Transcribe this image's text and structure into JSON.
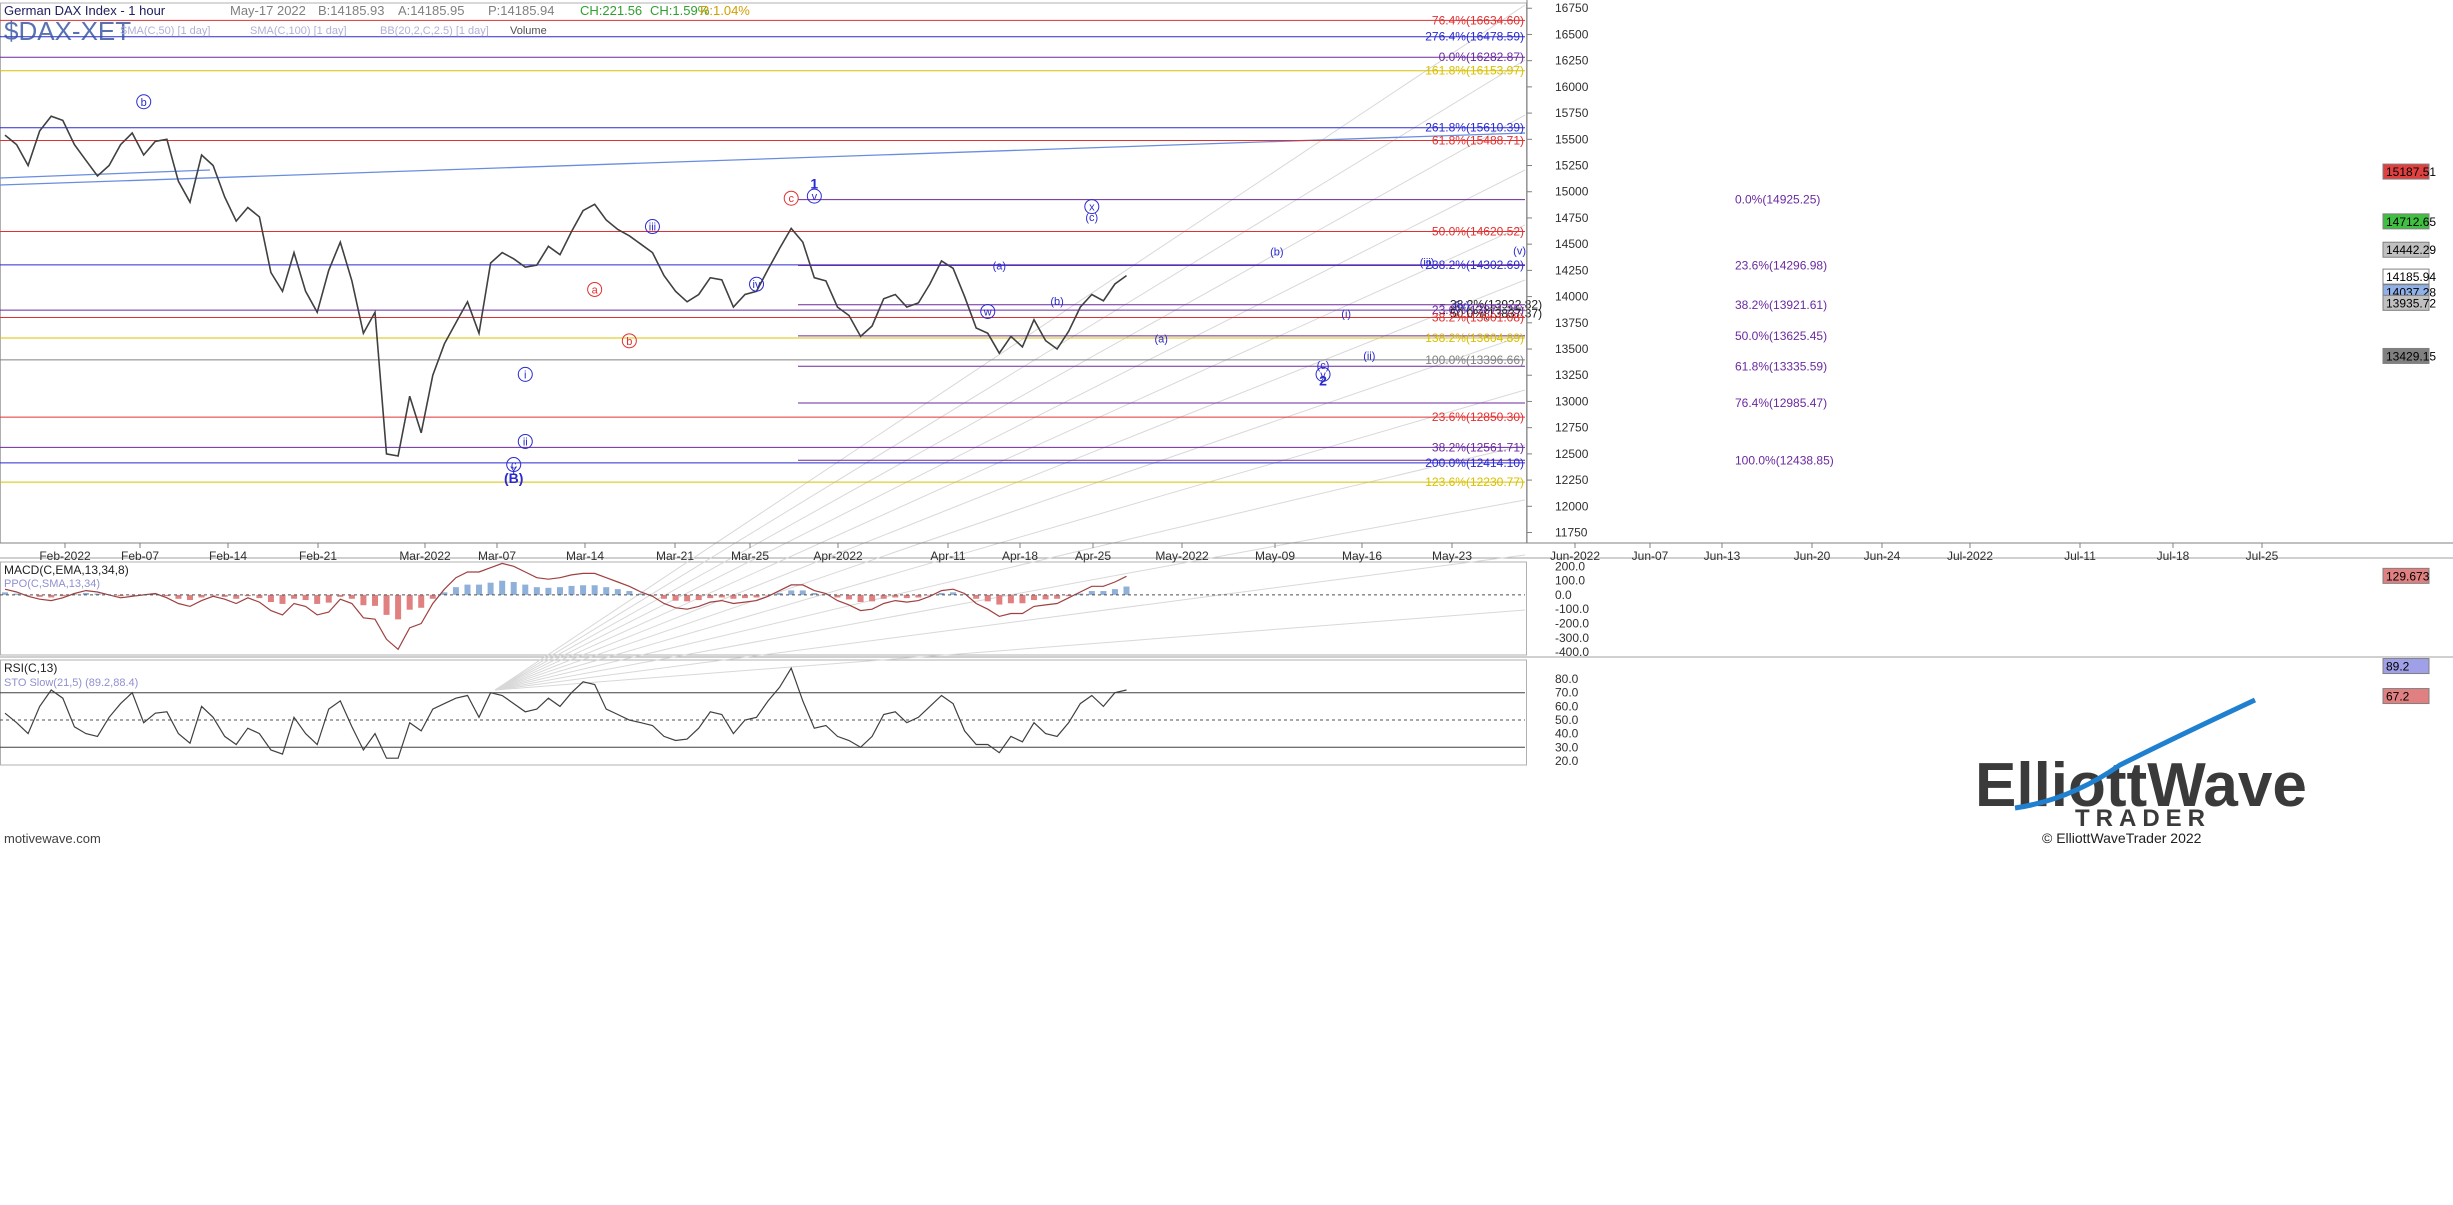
{
  "header": {
    "symbol": "$DAX-XET",
    "name": "German DAX Index - 1 hour",
    "date": "May-17 2022",
    "bid": "B:14185.93",
    "ask": "A:14185.95",
    "price": "P:14185.94",
    "change": "CH:221.56",
    "change_pct": "CH:1.59%",
    "range": "R:1.04%",
    "overlays": [
      "SMA(C,50) [1 day]",
      "SMA(C,100) [1 day]",
      "BB(20,2,C,2.5) [1 day]",
      "Volume"
    ]
  },
  "colors": {
    "red": "#e03030",
    "blue": "#2a2ad0",
    "purple": "#6a2aa0",
    "gold": "#d8c000",
    "gray": "#808080",
    "price": "#404040",
    "macd_pos": "#8fb0d8",
    "macd_neg": "#e08080"
  },
  "watermark_left": "motivewave.com",
  "branding": {
    "logo_main": "ElliottWave",
    "logo_sub": "TRADER",
    "copyright": "© ElliottWaveTrader 2022"
  },
  "chart_data": [
    {
      "type": "line",
      "title": "German DAX Index - 1 hour",
      "x_ticks": [
        "Feb-2022",
        "Feb-07",
        "Feb-14",
        "Feb-21",
        "Mar-2022",
        "Mar-07",
        "Mar-14",
        "Mar-21",
        "Mar-25",
        "Apr-2022",
        "Apr-11",
        "Apr-18",
        "Apr-25",
        "May-2022",
        "May-09",
        "May-16",
        "May-23",
        "Jun-2022",
        "Jun-07",
        "Jun-13",
        "Jun-20",
        "Jun-24",
        "Jul-2022",
        "Jul-11",
        "Jul-18",
        "Jul-25"
      ],
      "y_ticks": [
        16750,
        16500,
        16250,
        16000,
        15750,
        15500,
        15250,
        15000,
        14750,
        14500,
        14250,
        14000,
        13750,
        13500,
        13250,
        13000,
        12750,
        12500,
        12250,
        12000,
        11750
      ],
      "ylim": [
        11650,
        16800
      ],
      "series": [
        {
          "values": [
            15540,
            15450,
            15250,
            15580,
            15720,
            15680,
            15450,
            15300,
            15150,
            15250,
            15450,
            15560,
            15350,
            15480,
            15500,
            15100,
            14900,
            15350,
            15250,
            14950,
            14720,
            14850,
            14760,
            14230,
            14050,
            14420,
            14050,
            13850,
            14250,
            14520,
            14150,
            13650,
            13850,
            12500,
            12480,
            13050,
            12700,
            13250,
            13550,
            13750,
            13950,
            13650,
            14320,
            14420,
            14360,
            14280,
            14300,
            14480,
            14400,
            14620,
            14820,
            14880,
            14730,
            14640,
            14580,
            14500,
            14420,
            14200,
            14050,
            13950,
            14020,
            14180,
            14160,
            13900,
            14020,
            14050,
            14260,
            14460,
            14650,
            14520,
            14180,
            14150,
            13900,
            13820,
            13620,
            13720,
            13980,
            14020,
            13900,
            13940,
            14120,
            14340,
            14270,
            14000,
            13700,
            13650,
            13460,
            13620,
            13520,
            13780,
            13580,
            13500,
            13670,
            13900,
            14020,
            13960,
            14120,
            14200
          ]
        }
      ],
      "fib_levels": [
        {
          "label": "76.4%(16634.60)",
          "value": 16634.6,
          "color": "red"
        },
        {
          "label": "276.4%(16478.59)",
          "value": 16478.59,
          "color": "blue"
        },
        {
          "label": "0.0%(16282.87)",
          "value": 16282.87,
          "color": "purple"
        },
        {
          "label": "161.8%(16153.97)",
          "value": 16153.97,
          "color": "gold"
        },
        {
          "label": "261.8%(15610.39)",
          "value": 15610.39,
          "color": "blue"
        },
        {
          "label": "61.8%(15488.71)",
          "value": 15488.71,
          "color": "red"
        },
        {
          "label": "0.0%(14925.25)",
          "value": 14925.25,
          "color": "purple",
          "start": "Mar-29"
        },
        {
          "label": "50.0%(14620.52)",
          "value": 14620.52,
          "color": "red"
        },
        {
          "label": "238.2%(14302.69)",
          "value": 14302.69,
          "color": "blue"
        },
        {
          "label": "23.6%(14296.98)",
          "value": 14296.98,
          "color": "purple",
          "start": "Mar-29"
        },
        {
          "label": "38.2%(13922.82)",
          "value": 13922.82,
          "color": "black",
          "start": "May-17"
        },
        {
          "label": "38.2%(13921.61)",
          "value": 13921.61,
          "color": "purple",
          "start": "Mar-29"
        },
        {
          "label": "23.6%(13871.25)",
          "value": 13871.25,
          "color": "purple"
        },
        {
          "label": "50.0%(13837.37)",
          "value": 13837.37,
          "color": "black",
          "start": "May-17"
        },
        {
          "label": "38.2%(13801.08)",
          "value": 13801.08,
          "color": "red"
        },
        {
          "label": "50.0%(13625.45)",
          "value": 13625.45,
          "color": "purple",
          "start": "Mar-29"
        },
        {
          "label": "138.2%(13604.89)",
          "value": 13604.89,
          "color": "gold"
        },
        {
          "label": "100.0%(13396.66)",
          "value": 13396.66,
          "color": "gray"
        },
        {
          "label": "61.8%(13335.59)",
          "value": 13335.59,
          "color": "purple",
          "start": "Mar-29"
        },
        {
          "label": "76.4%(12985.47)",
          "value": 12985.47,
          "color": "purple",
          "start": "Mar-29"
        },
        {
          "label": "23.6%(12850.30)",
          "value": 12850.3,
          "color": "red"
        },
        {
          "label": "38.2%(12561.71)",
          "value": 12561.71,
          "color": "purple"
        },
        {
          "label": "100.0%(12438.85)",
          "value": 12438.85,
          "color": "purple",
          "start": "Mar-29"
        },
        {
          "label": "200.0%(12414.10)",
          "value": 12414.1,
          "color": "blue"
        },
        {
          "label": "123.6%(12230.77)",
          "value": 12230.77,
          "color": "gold"
        }
      ],
      "price_badges": [
        {
          "label": "15187.51",
          "value": 15187.51,
          "bg": "#e04040"
        },
        {
          "label": "14712.65",
          "value": 14712.65,
          "bg": "#40c040"
        },
        {
          "label": "14442.29",
          "value": 14442.29,
          "bg": "#c0c0c0"
        },
        {
          "label": "14185.94",
          "value": 14185.94,
          "bg": "#ffffff"
        },
        {
          "label": "14037.28",
          "value": 14037.28,
          "bg": "#8fb0e8"
        },
        {
          "label": "13935.72",
          "value": 13935.72,
          "bg": "#c0c0c0"
        },
        {
          "label": "13429.15",
          "value": 13429.15,
          "bg": "#808080"
        }
      ],
      "wave_labels": [
        {
          "text": "b",
          "x": 12,
          "y": 15820,
          "color": "blue",
          "circle": true
        },
        {
          "text": "c",
          "x": 68,
          "y": 14900,
          "color": "red",
          "circle": true
        },
        {
          "text": "1",
          "x": 70,
          "y": 15030,
          "color": "blue",
          "circle": false,
          "bold": true
        },
        {
          "text": "v",
          "x": 70,
          "y": 14920,
          "color": "blue",
          "circle": true
        },
        {
          "text": "a",
          "x": 51,
          "y": 14030,
          "color": "red",
          "circle": true
        },
        {
          "text": "b",
          "x": 54,
          "y": 13540,
          "color": "red",
          "circle": true
        },
        {
          "text": "iii",
          "x": 56,
          "y": 14630,
          "color": "blue",
          "circle": true
        },
        {
          "text": "iv",
          "x": 65,
          "y": 14080,
          "color": "blue",
          "circle": true
        },
        {
          "text": "i",
          "x": 45,
          "y": 13220,
          "color": "blue",
          "circle": true
        },
        {
          "text": "ii",
          "x": 45,
          "y": 12580,
          "color": "blue",
          "circle": true
        },
        {
          "text": "c",
          "x": 44,
          "y": 12360,
          "color": "blue",
          "circle": true
        },
        {
          "text": "Y",
          "x": 44,
          "y": 12310,
          "color": "blue",
          "circle": false
        },
        {
          "text": "(B)",
          "x": 44,
          "y": 12220,
          "color": "blue",
          "circle": false,
          "bold": true
        },
        {
          "text": "(a)",
          "x": 86,
          "y": 14260,
          "color": "blue",
          "circle": false
        },
        {
          "text": "w",
          "x": 85,
          "y": 13820,
          "color": "blue",
          "circle": true
        },
        {
          "text": "(b)",
          "x": 91,
          "y": 13920,
          "color": "blue",
          "circle": false
        },
        {
          "text": "x",
          "x": 94,
          "y": 14820,
          "color": "blue",
          "circle": true
        },
        {
          "text": "(c)",
          "x": 94,
          "y": 14720,
          "color": "blue",
          "circle": false
        },
        {
          "text": "(a)",
          "x": 100,
          "y": 13560,
          "color": "blue",
          "circle": false
        },
        {
          "text": "(b)",
          "x": 110,
          "y": 14390,
          "color": "blue",
          "circle": false
        },
        {
          "text": "(i)",
          "x": 116,
          "y": 13800,
          "color": "blue",
          "circle": false
        },
        {
          "text": "(ii)",
          "x": 118,
          "y": 13400,
          "color": "blue",
          "circle": false
        },
        {
          "text": "(c)",
          "x": 114,
          "y": 13310,
          "color": "blue",
          "circle": false
        },
        {
          "text": "y",
          "x": 114,
          "y": 13220,
          "color": "blue",
          "circle": true
        },
        {
          "text": "2",
          "x": 114,
          "y": 13150,
          "color": "blue",
          "circle": false,
          "bold": true
        },
        {
          "text": "(iii)",
          "x": 123,
          "y": 14290,
          "color": "blue",
          "circle": false
        },
        {
          "text": "(iv)",
          "x": 126,
          "y": 13880,
          "color": "blue",
          "circle": false
        },
        {
          "text": "(v)",
          "x": 131,
          "y": 14400,
          "color": "blue",
          "circle": false
        }
      ]
    },
    {
      "type": "line",
      "title": "MACD(C,EMA,13,34,8)",
      "legend": [
        "MACD(C,EMA,13,34,8)",
        "PPO(C,SMA,13,34)"
      ],
      "y_ticks": [
        200,
        100,
        0,
        -100,
        -200,
        -300,
        -400
      ],
      "ylim": [
        -420,
        230
      ],
      "current_badge": "129.673",
      "series": [
        {
          "name": "MACD",
          "values": [
            40,
            20,
            -10,
            -30,
            -40,
            -20,
            10,
            30,
            20,
            0,
            -20,
            -10,
            0,
            10,
            -20,
            -60,
            -80,
            -40,
            -10,
            -30,
            -60,
            -20,
            -50,
            -110,
            -140,
            -60,
            -80,
            -140,
            -120,
            -30,
            -60,
            -160,
            -170,
            -310,
            -380,
            -230,
            -200,
            -60,
            40,
            120,
            160,
            160,
            190,
            220,
            200,
            160,
            120,
            110,
            120,
            140,
            150,
            150,
            120,
            90,
            60,
            20,
            -10,
            -60,
            -90,
            -100,
            -80,
            -50,
            -40,
            -60,
            -50,
            -40,
            -10,
            30,
            70,
            70,
            30,
            10,
            -40,
            -70,
            -110,
            -100,
            -60,
            -40,
            -50,
            -40,
            -10,
            30,
            40,
            10,
            -60,
            -100,
            -150,
            -130,
            -130,
            -80,
            -70,
            -60,
            -20,
            20,
            60,
            60,
            90,
            130
          ]
        }
      ]
    },
    {
      "type": "line",
      "title": "RSI(C,13)",
      "legend": [
        "RSI(C,13)",
        "STO Slow(21,5) (89.2,88.4)"
      ],
      "y_ticks": [
        80.0,
        70.0,
        60.0,
        50.0,
        40.0,
        30.0,
        20.0
      ],
      "ylim": [
        17,
        94
      ],
      "current_badges": [
        "89.2",
        "67.2"
      ],
      "series": [
        {
          "name": "RSI",
          "values": [
            55,
            48,
            40,
            60,
            72,
            66,
            45,
            40,
            38,
            52,
            62,
            70,
            48,
            55,
            56,
            40,
            33,
            60,
            52,
            38,
            32,
            44,
            40,
            28,
            25,
            52,
            40,
            32,
            58,
            64,
            45,
            28,
            40,
            22,
            22,
            48,
            42,
            58,
            62,
            66,
            68,
            52,
            70,
            68,
            62,
            56,
            58,
            66,
            60,
            70,
            78,
            76,
            58,
            54,
            50,
            48,
            46,
            38,
            35,
            36,
            44,
            56,
            54,
            40,
            50,
            52,
            64,
            74,
            88,
            64,
            44,
            46,
            38,
            35,
            30,
            38,
            54,
            56,
            48,
            52,
            60,
            68,
            62,
            42,
            32,
            32,
            26,
            38,
            34,
            48,
            40,
            38,
            48,
            62,
            68,
            60,
            70,
            72
          ]
        }
      ]
    }
  ]
}
